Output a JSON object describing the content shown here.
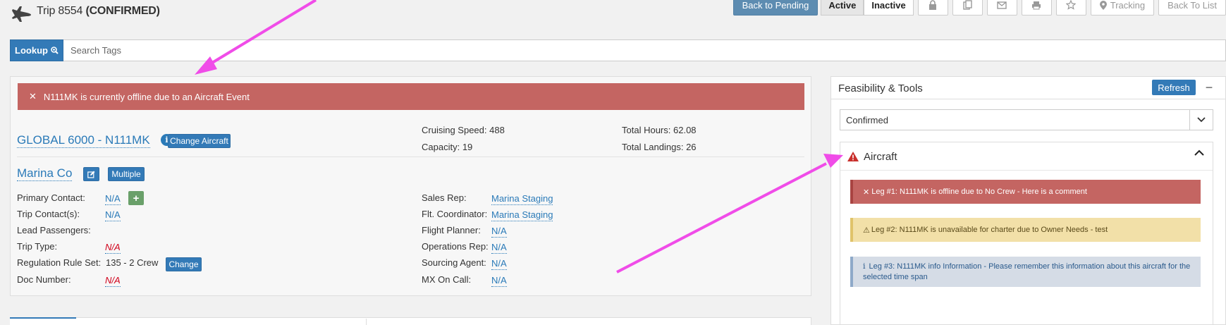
{
  "header": {
    "trip_label": "Trip 8554",
    "trip_status": "(CONFIRMED)"
  },
  "toolbar": {
    "back_to_pending": "Back to Pending",
    "active": "Active",
    "inactive": "Inactive",
    "tracking": "Tracking",
    "back_to_list": "Back To List"
  },
  "lookup": {
    "button": "Lookup",
    "placeholder": "Search Tags"
  },
  "main": {
    "alert": "N111MK is currently offline due to an Aircraft Event",
    "aircraft": "GLOBAL 6000 - N111MK",
    "change_aircraft": "Change Aircraft",
    "cruising_speed_label": "Cruising Speed:",
    "cruising_speed": "488",
    "capacity_label": "Capacity:",
    "capacity": "19",
    "total_hours_label": "Total Hours:",
    "total_hours": "62.08",
    "total_landings_label": "Total Landings:",
    "total_landings": "26",
    "client": "Marina Co",
    "multiple": "Multiple",
    "left_fields": [
      {
        "label": "Primary Contact:",
        "value": "N/A"
      },
      {
        "label": "Trip Contact(s):",
        "value": "N/A"
      },
      {
        "label": "Lead Passengers:",
        "value": ""
      },
      {
        "label": "Trip Type:",
        "value": "N/A"
      },
      {
        "label": "Regulation Rule Set:",
        "value": "135 - 2 Crew"
      },
      {
        "label": "Doc Number:",
        "value": "N/A"
      }
    ],
    "change": "Change",
    "right_fields": [
      {
        "label": "Sales Rep:",
        "value": "Marina Staging"
      },
      {
        "label": "Flt. Coordinator:",
        "value": "Marina Staging"
      },
      {
        "label": "Flight Planner:",
        "value": "N/A"
      },
      {
        "label": "Operations Rep:",
        "value": "N/A"
      },
      {
        "label": "Sourcing Agent:",
        "value": "N/A"
      },
      {
        "label": "MX On Call:",
        "value": "N/A"
      }
    ]
  },
  "feasibility": {
    "title": "Feasibility & Tools",
    "refresh": "Refresh",
    "status_select": "Confirmed",
    "section_title": "Aircraft",
    "legs": [
      {
        "icon": "✕",
        "text": "Leg #1: N111MK is offline due to No Crew - Here is a comment"
      },
      {
        "icon": "⚠",
        "text": "Leg #2: N111MK is unavailable for charter due to Owner Needs - test"
      },
      {
        "icon": "i",
        "text": "Leg #3: N111MK info Information - Please remember this information about this aircraft for the selected time span"
      }
    ]
  },
  "colors": {
    "primary": "#337ab7",
    "danger": "#c46562",
    "warning": "#f2e0a8",
    "info": "#d5dce6",
    "annotation_arrow": "#f04ce8"
  }
}
